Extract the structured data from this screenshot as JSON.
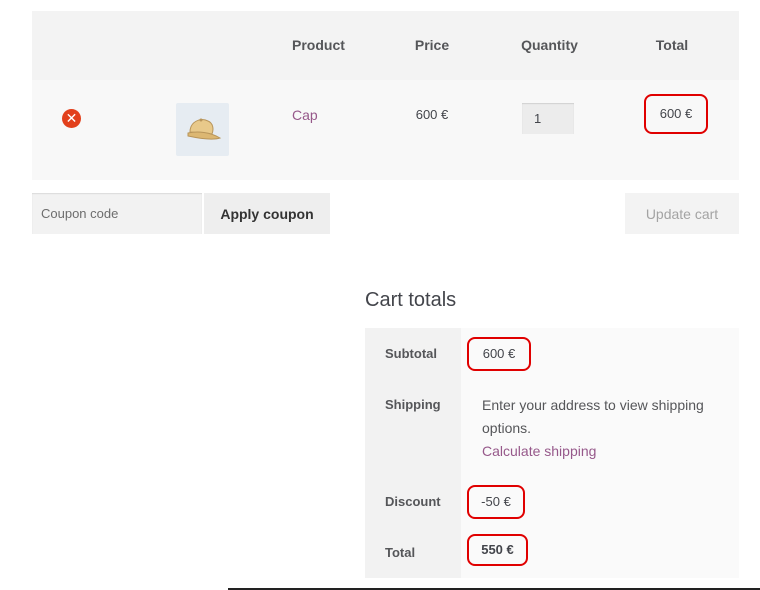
{
  "cart_table": {
    "headers": {
      "product": "Product",
      "price": "Price",
      "quantity": "Quantity",
      "total": "Total"
    },
    "items": [
      {
        "remove_icon": "remove-circle-icon",
        "thumbnail_icon": "cap-icon",
        "product_name": "Cap",
        "price": "600 €",
        "quantity": "1",
        "total": "600 €"
      }
    ]
  },
  "actions": {
    "coupon_placeholder": "Coupon code",
    "apply_coupon_label": "Apply coupon",
    "update_cart_label": "Update cart"
  },
  "cart_totals": {
    "title": "Cart totals",
    "subtotal_label": "Subtotal",
    "subtotal_value": "600 €",
    "shipping_label": "Shipping",
    "shipping_text": "Enter your address to view shipping options.",
    "calculate_shipping_link": "Calculate shipping",
    "discount_label": "Discount",
    "discount_value": "-50 €",
    "total_label": "Total",
    "total_value": "550 €"
  },
  "colors": {
    "accent_link": "#96588a",
    "remove_red": "#e2401c",
    "highlight_red": "#e00000"
  }
}
